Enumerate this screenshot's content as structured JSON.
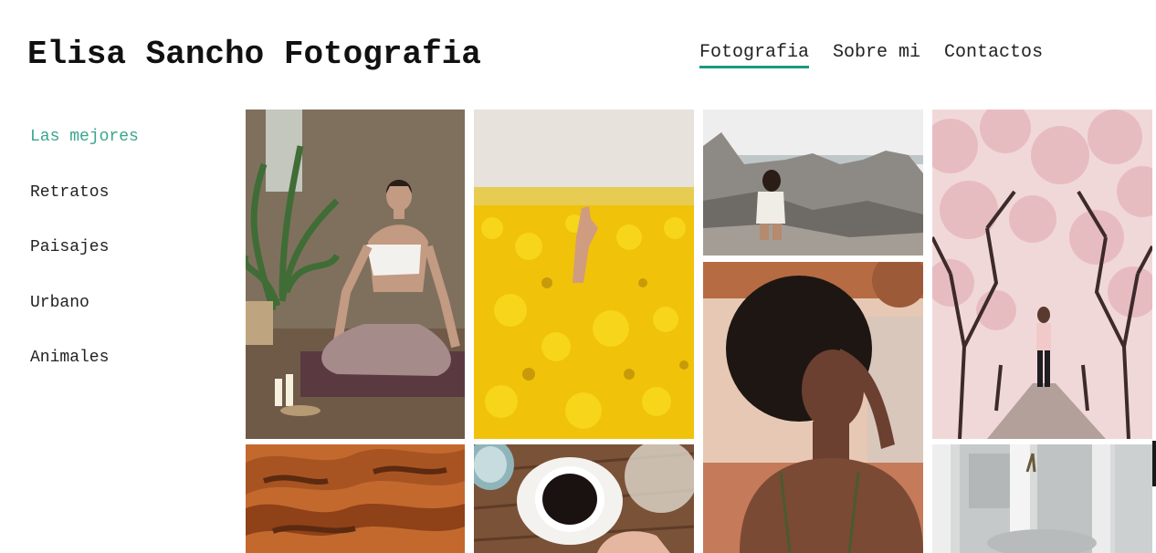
{
  "site": {
    "title": "Elisa Sancho Fotografia"
  },
  "top_nav": {
    "items": [
      {
        "label": "Fotografia",
        "active": true
      },
      {
        "label": "Sobre mi",
        "active": false
      },
      {
        "label": "Contactos",
        "active": false
      }
    ]
  },
  "side_nav": {
    "items": [
      {
        "label": "Las mejores",
        "active": true
      },
      {
        "label": "Retratos",
        "active": false
      },
      {
        "label": "Paisajes",
        "active": false
      },
      {
        "label": "Urbano",
        "active": false
      },
      {
        "label": "Animales",
        "active": false
      }
    ]
  },
  "colors": {
    "accent": "#1a9a7f",
    "active_side_link": "#3aa58d",
    "text": "#222222"
  }
}
